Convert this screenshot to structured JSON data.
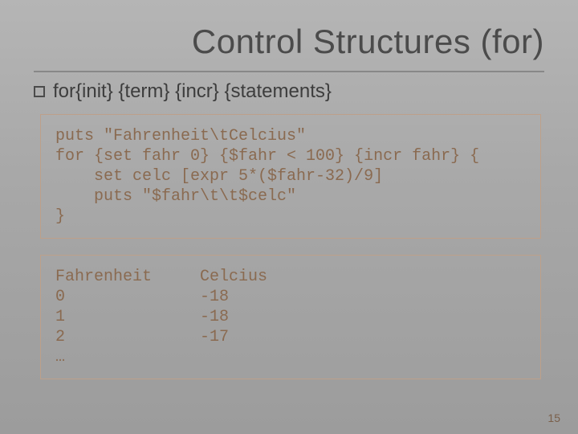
{
  "title": "Control Structures (for)",
  "syntax": {
    "keyword": "for",
    "rest": " {init} {term} {incr} {statements}"
  },
  "code": {
    "l1": "puts \"Fahrenheit\\tCelcius\"",
    "l2": "for {set fahr 0} {$fahr < 100} {incr fahr} {",
    "l3": "    set celc [expr 5*($fahr-32)/9]",
    "l4": "    puts \"$fahr\\t\\t$celc\"",
    "l5": "}"
  },
  "output": {
    "header": {
      "f": "Fahrenheit",
      "c": "Celcius"
    },
    "rows": [
      {
        "f": "0",
        "c": "-18"
      },
      {
        "f": "1",
        "c": "-18"
      },
      {
        "f": "2",
        "c": "-17"
      }
    ],
    "ellipsis": "…"
  },
  "page": "15"
}
